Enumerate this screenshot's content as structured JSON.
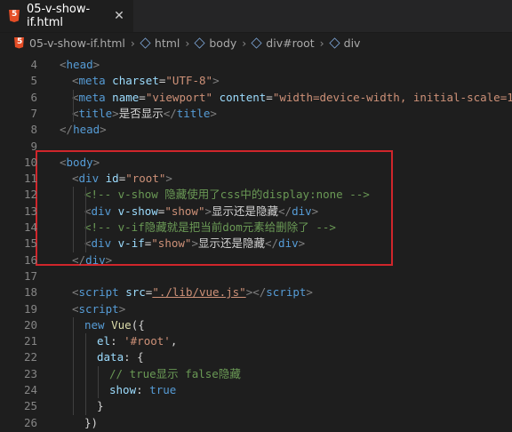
{
  "tab": {
    "filename": "05-v-show-if.html",
    "close_glyph": "✕"
  },
  "breadcrumb": {
    "items": [
      "05-v-show-if.html",
      "html",
      "body",
      "div#root",
      "div"
    ],
    "separator": "›"
  },
  "colors": {
    "tag": "#569cd6",
    "attr": "#9cdcfe",
    "string": "#ce9178",
    "comment": "#6a9955",
    "text": "#d4d4d4",
    "highlight_box": "#d0262b"
  },
  "lines": [
    {
      "n": "4",
      "tokens": [
        [
          "t-punc",
          "<"
        ],
        [
          "t-tag",
          "head"
        ],
        [
          "t-punc",
          ">"
        ]
      ]
    },
    {
      "n": "5",
      "tokens": [
        [
          "t-punc",
          "<"
        ],
        [
          "t-tag",
          "meta "
        ],
        [
          "t-attr",
          "charset"
        ],
        [
          "t-text",
          "="
        ],
        [
          "t-str",
          "\"UTF-8\""
        ],
        [
          "t-punc",
          ">"
        ]
      ]
    },
    {
      "n": "6",
      "tokens": [
        [
          "t-punc",
          "<"
        ],
        [
          "t-tag",
          "meta "
        ],
        [
          "t-attr",
          "name"
        ],
        [
          "t-text",
          "="
        ],
        [
          "t-str",
          "\"viewport\" "
        ],
        [
          "t-attr",
          "content"
        ],
        [
          "t-text",
          "="
        ],
        [
          "t-str",
          "\"width=device-width, initial-scale=1."
        ]
      ]
    },
    {
      "n": "7",
      "tokens": [
        [
          "t-punc",
          "<"
        ],
        [
          "t-tag",
          "title"
        ],
        [
          "t-punc",
          ">"
        ],
        [
          "t-text",
          "是否显示"
        ],
        [
          "t-punc",
          "</"
        ],
        [
          "t-tag",
          "title"
        ],
        [
          "t-punc",
          ">"
        ]
      ]
    },
    {
      "n": "8",
      "tokens": [
        [
          "t-punc",
          "</"
        ],
        [
          "t-tag",
          "head"
        ],
        [
          "t-punc",
          ">"
        ]
      ]
    },
    {
      "n": "9",
      "tokens": []
    },
    {
      "n": "10",
      "tokens": [
        [
          "t-punc",
          "<"
        ],
        [
          "t-tag",
          "body"
        ],
        [
          "t-punc",
          ">"
        ]
      ]
    },
    {
      "n": "11",
      "tokens": [
        [
          "t-punc",
          "<"
        ],
        [
          "t-tag",
          "div "
        ],
        [
          "t-attr",
          "id"
        ],
        [
          "t-text",
          "="
        ],
        [
          "t-str",
          "\"root\""
        ],
        [
          "t-punc",
          ">"
        ]
      ]
    },
    {
      "n": "12",
      "tokens": [
        [
          "t-com",
          "<!-- v-show 隐藏使用了css中的display:none -->"
        ]
      ]
    },
    {
      "n": "13",
      "tokens": [
        [
          "t-punc",
          "<"
        ],
        [
          "t-tag",
          "div "
        ],
        [
          "t-attr",
          "v-show"
        ],
        [
          "t-text",
          "="
        ],
        [
          "t-str",
          "\"show\""
        ],
        [
          "t-punc",
          ">"
        ],
        [
          "t-text",
          "显示还是隐藏"
        ],
        [
          "t-punc",
          "</"
        ],
        [
          "t-tag",
          "div"
        ],
        [
          "t-punc",
          ">"
        ]
      ]
    },
    {
      "n": "14",
      "tokens": [
        [
          "t-com",
          "<!-- v-if隐藏就是把当前dom元素给删除了 -->"
        ]
      ]
    },
    {
      "n": "15",
      "tokens": [
        [
          "t-punc",
          "<"
        ],
        [
          "t-tag",
          "div "
        ],
        [
          "t-attr",
          "v-if"
        ],
        [
          "t-text",
          "="
        ],
        [
          "t-str",
          "\"show\""
        ],
        [
          "t-punc",
          ">"
        ],
        [
          "t-text",
          "显示还是隐藏"
        ],
        [
          "t-punc",
          "</"
        ],
        [
          "t-tag",
          "div"
        ],
        [
          "t-punc",
          ">"
        ]
      ]
    },
    {
      "n": "16",
      "tokens": [
        [
          "t-punc",
          "</"
        ],
        [
          "t-tag",
          "div"
        ],
        [
          "t-punc",
          ">"
        ]
      ]
    },
    {
      "n": "17",
      "tokens": []
    },
    {
      "n": "18",
      "tokens": [
        [
          "t-punc",
          "<"
        ],
        [
          "t-tag",
          "script "
        ],
        [
          "t-attr",
          "src"
        ],
        [
          "t-text",
          "="
        ],
        [
          "t-link",
          "\"./lib/vue.js\""
        ],
        [
          "t-punc",
          "></"
        ],
        [
          "t-tag",
          "script"
        ],
        [
          "t-punc",
          ">"
        ]
      ]
    },
    {
      "n": "19",
      "tokens": [
        [
          "t-punc",
          "<"
        ],
        [
          "t-tag",
          "script"
        ],
        [
          "t-punc",
          ">"
        ]
      ]
    },
    {
      "n": "20",
      "tokens": [
        [
          "t-kw",
          "new "
        ],
        [
          "t-fn",
          "Vue"
        ],
        [
          "t-text",
          "({"
        ]
      ]
    },
    {
      "n": "21",
      "tokens": [
        [
          "t-attr",
          "el"
        ],
        [
          "t-text",
          ": "
        ],
        [
          "t-str",
          "'#root'"
        ],
        [
          "t-text",
          ","
        ]
      ]
    },
    {
      "n": "22",
      "tokens": [
        [
          "t-attr",
          "data"
        ],
        [
          "t-text",
          ": {"
        ]
      ]
    },
    {
      "n": "23",
      "tokens": [
        [
          "t-com",
          "// true显示 false隐藏"
        ]
      ]
    },
    {
      "n": "24",
      "tokens": [
        [
          "t-attr",
          "show"
        ],
        [
          "t-text",
          ": "
        ],
        [
          "t-bool",
          "true"
        ]
      ]
    },
    {
      "n": "25",
      "tokens": [
        [
          "t-text",
          "}"
        ]
      ]
    },
    {
      "n": "26",
      "tokens": [
        [
          "t-text",
          "})"
        ]
      ]
    }
  ]
}
